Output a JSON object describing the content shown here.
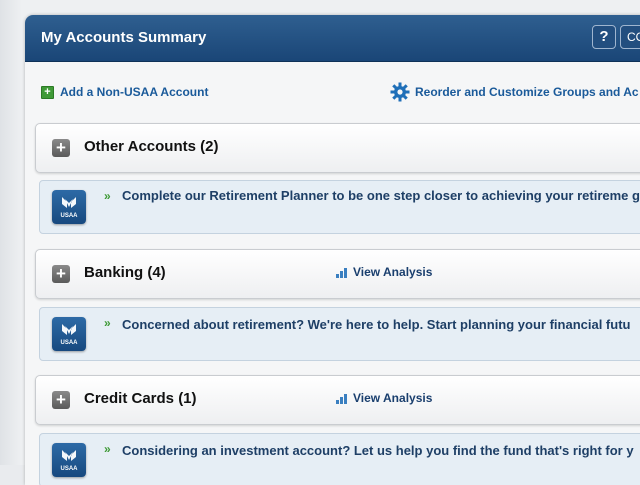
{
  "header": {
    "title": "My Accounts Summary",
    "help_label": "?",
    "cut_button_label": "CO"
  },
  "toolbar": {
    "add_account_label": "Add a Non-USAA Account",
    "reorder_label": "Reorder and Customize Groups and Ac"
  },
  "groups": [
    {
      "title": "Other Accounts (2)",
      "analysis_label": ""
    },
    {
      "title": "Banking (4)",
      "analysis_label": "View Analysis"
    },
    {
      "title": "Credit Cards (1)",
      "analysis_label": "View Analysis"
    }
  ],
  "promos": [
    {
      "arrow": "»",
      "text": "Complete our Retirement Planner to be one step closer to achieving your retireme goals."
    },
    {
      "arrow": "»",
      "text": "Concerned about retirement? We're here to help. Start planning your financial futu"
    },
    {
      "arrow": "»",
      "text": "Considering an investment account? Let us help you find the fund that's right for y"
    }
  ],
  "logo": {
    "text": "USAA"
  },
  "colors": {
    "header_blue": "#1a4677",
    "link_blue": "#1a5a9a",
    "green": "#3f9a37"
  }
}
